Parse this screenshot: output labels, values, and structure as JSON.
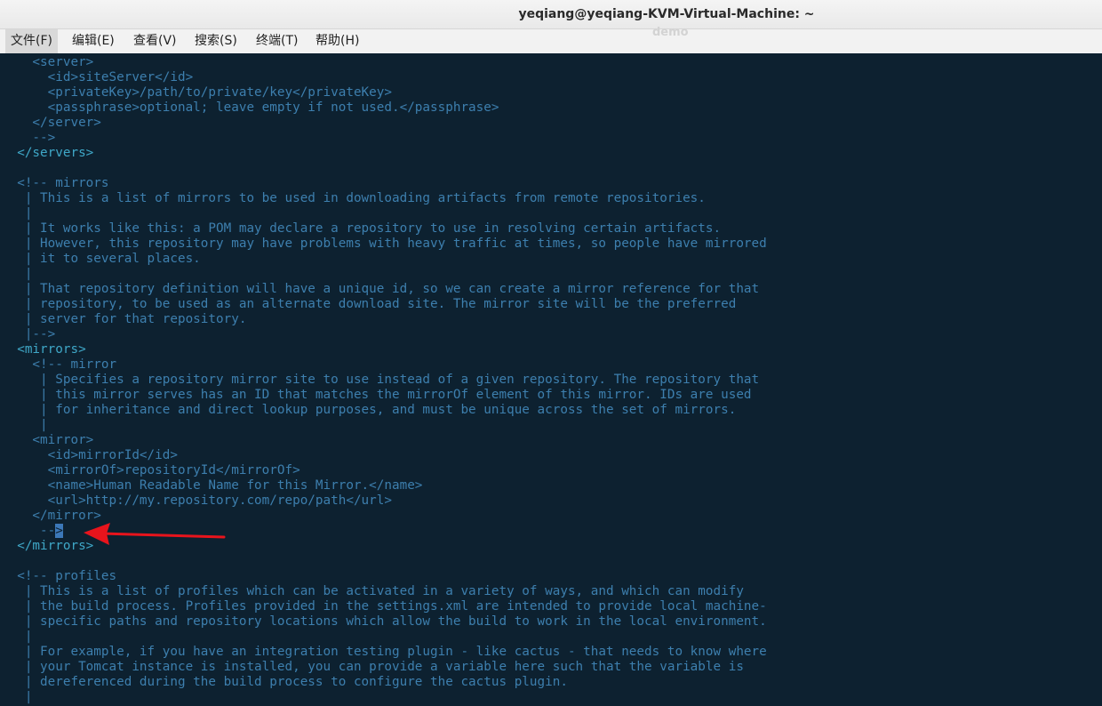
{
  "window": {
    "title": "yeqiang@yeqiang-KVM-Virtual-Machine: ~",
    "ghost_text": "demo"
  },
  "menu": [
    {
      "label": "文件(F)"
    },
    {
      "label": "编辑(E)"
    },
    {
      "label": "查看(V)"
    },
    {
      "label": "搜索(S)"
    },
    {
      "label": "终端(T)"
    },
    {
      "label": "帮助(H)"
    }
  ],
  "terminal": {
    "lines": [
      "    <server>",
      "      <id>siteServer</id>",
      "      <privateKey>/path/to/private/key</privateKey>",
      "      <passphrase>optional; leave empty if not used.</passphrase>",
      "    </server>",
      "    -->",
      "  </servers>",
      "",
      "  <!-- mirrors",
      "   | This is a list of mirrors to be used in downloading artifacts from remote repositories.",
      "   |",
      "   | It works like this: a POM may declare a repository to use in resolving certain artifacts.",
      "   | However, this repository may have problems with heavy traffic at times, so people have mirrored",
      "   | it to several places.",
      "   |",
      "   | That repository definition will have a unique id, so we can create a mirror reference for that",
      "   | repository, to be used as an alternate download site. The mirror site will be the preferred",
      "   | server for that repository.",
      "   |-->",
      "  <mirrors>",
      "    <!-- mirror",
      "     | Specifies a repository mirror site to use instead of a given repository. The repository that",
      "     | this mirror serves has an ID that matches the mirrorOf element of this mirror. IDs are used",
      "     | for inheritance and direct lookup purposes, and must be unique across the set of mirrors.",
      "     |",
      "    <mirror>",
      "      <id>mirrorId</id>",
      "      <mirrorOf>repositoryId</mirrorOf>",
      "      <name>Human Readable Name for this Mirror.</name>",
      "      <url>http://my.repository.com/repo/path</url>",
      "    </mirror>",
      "     --",
      "  </mirrors>",
      "",
      "  <!-- profiles",
      "   | This is a list of profiles which can be activated in a variety of ways, and which can modify",
      "   | the build process. Profiles provided in the settings.xml are intended to provide local machine-",
      "   | specific paths and repository locations which allow the build to work in the local environment.",
      "   |",
      "   | For example, if you have an integration testing plugin - like cactus - that needs to know where",
      "   | your Tomcat instance is installed, you can provide a variable here such that the variable is",
      "   | dereferenced during the build process to configure the cactus plugin.",
      "   |"
    ],
    "cursor_char": ">",
    "cursor_line": 31,
    "tag_lines": [
      6,
      19,
      32
    ]
  },
  "colors": {
    "background": "#0d2130",
    "text": "#3d7fae",
    "tag": "#3fa8c8",
    "cursor": "#3c78b8",
    "arrow": "#e8141c"
  }
}
